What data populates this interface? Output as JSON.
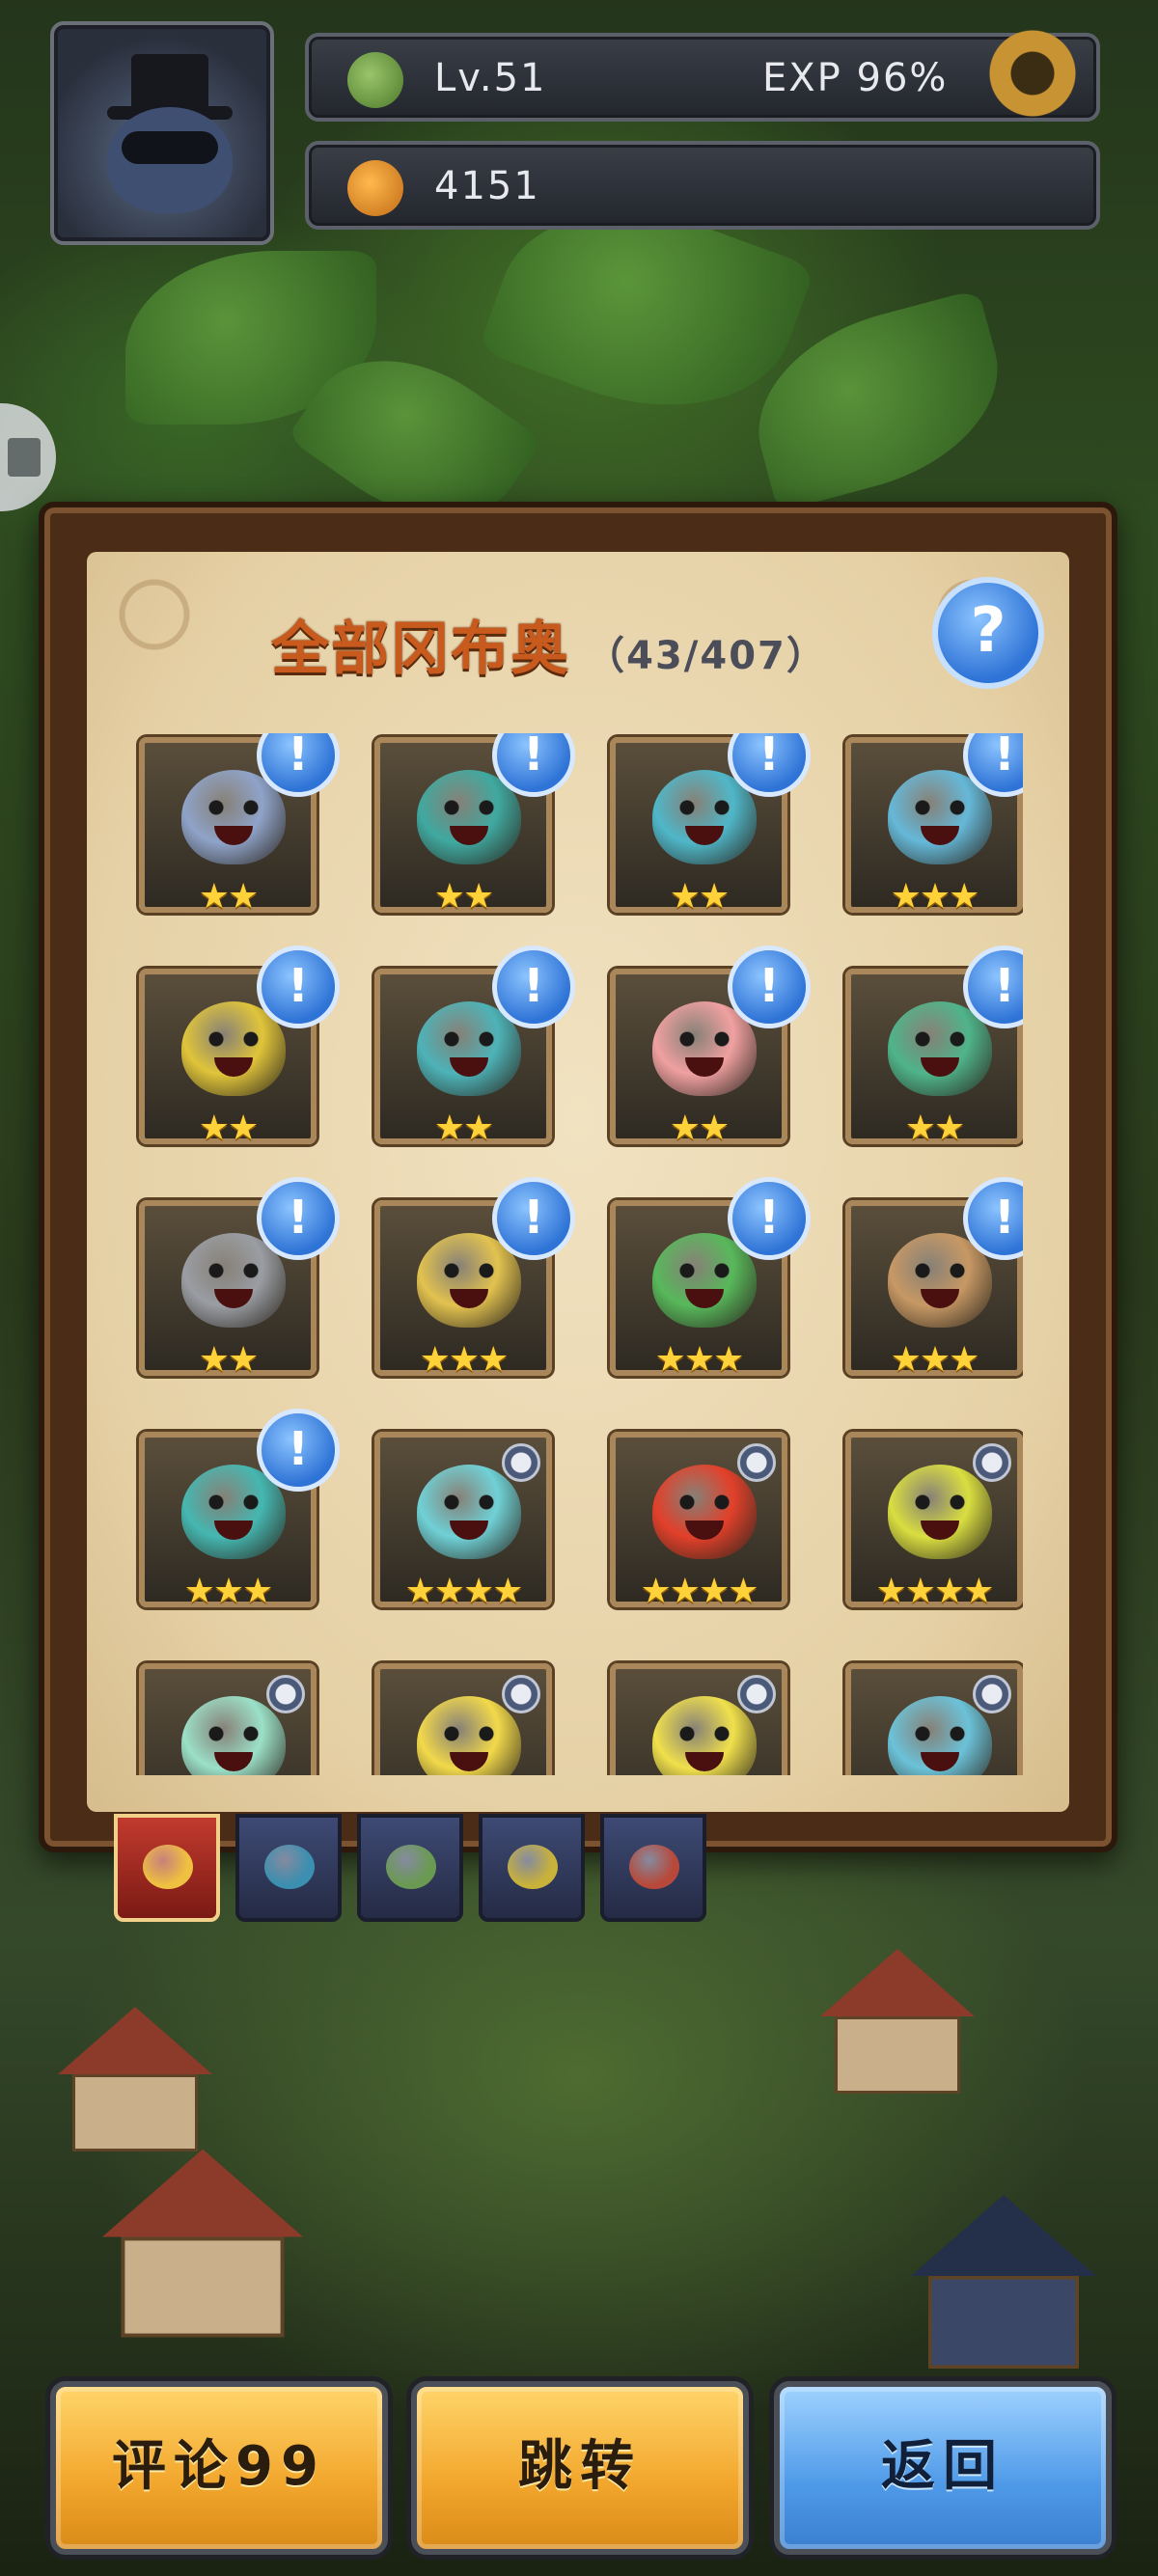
{
  "hud": {
    "level": "Lv.51",
    "exp": "EXP 96%",
    "coins": "4151"
  },
  "collection": {
    "title": "全部冈布奥",
    "count": "（43/407）",
    "help_label": "?"
  },
  "cards": [
    {
      "stars": "★★",
      "alert": "!",
      "color": "#8fa3c9"
    },
    {
      "stars": "★★",
      "alert": "!",
      "color": "#3fa9a0"
    },
    {
      "stars": "★★",
      "alert": "!",
      "color": "#4fb7c9"
    },
    {
      "stars": "★★★",
      "alert": "!",
      "color": "#65b8d8"
    },
    {
      "stars": "★★",
      "alert": "!",
      "color": "#e0c43a"
    },
    {
      "stars": "★★",
      "alert": "!",
      "color": "#4db3b8"
    },
    {
      "stars": "★★",
      "alert": "!",
      "color": "#f0a0a0"
    },
    {
      "stars": "★★",
      "alert": "!",
      "color": "#4fb48a"
    },
    {
      "stars": "★★",
      "alert": "!",
      "color": "#9a9da3"
    },
    {
      "stars": "★★★",
      "alert": "!",
      "color": "#e2c24f"
    },
    {
      "stars": "★★★",
      "alert": "!",
      "color": "#58b85b"
    },
    {
      "stars": "★★★",
      "alert": "!",
      "color": "#c79864"
    },
    {
      "stars": "★★★",
      "alert": "!",
      "color": "#45b7b1"
    },
    {
      "stars": "★★★★",
      "alert": "",
      "color": "#6fd1d6"
    },
    {
      "stars": "★★★★",
      "alert": "",
      "color": "#e2402a"
    },
    {
      "stars": "★★★★",
      "alert": "",
      "color": "#d9de40"
    },
    {
      "stars": "",
      "alert": "",
      "color": "#9be0c8"
    },
    {
      "stars": "",
      "alert": "",
      "color": "#f2d94a"
    },
    {
      "stars": "",
      "alert": "",
      "color": "#f0e04c"
    },
    {
      "stars": "",
      "alert": "",
      "color": "#6bc2d8"
    }
  ],
  "faction_tabs": [
    {
      "name": "all",
      "color": "#f0c040"
    },
    {
      "name": "faction-2",
      "color": "#3b8fb0"
    },
    {
      "name": "faction-3",
      "color": "#6a9a52"
    },
    {
      "name": "faction-4",
      "color": "#c9b23a"
    },
    {
      "name": "faction-5",
      "color": "#b8493a"
    }
  ],
  "buttons": {
    "comment": "评论99",
    "jump": "跳转",
    "back": "返回"
  }
}
